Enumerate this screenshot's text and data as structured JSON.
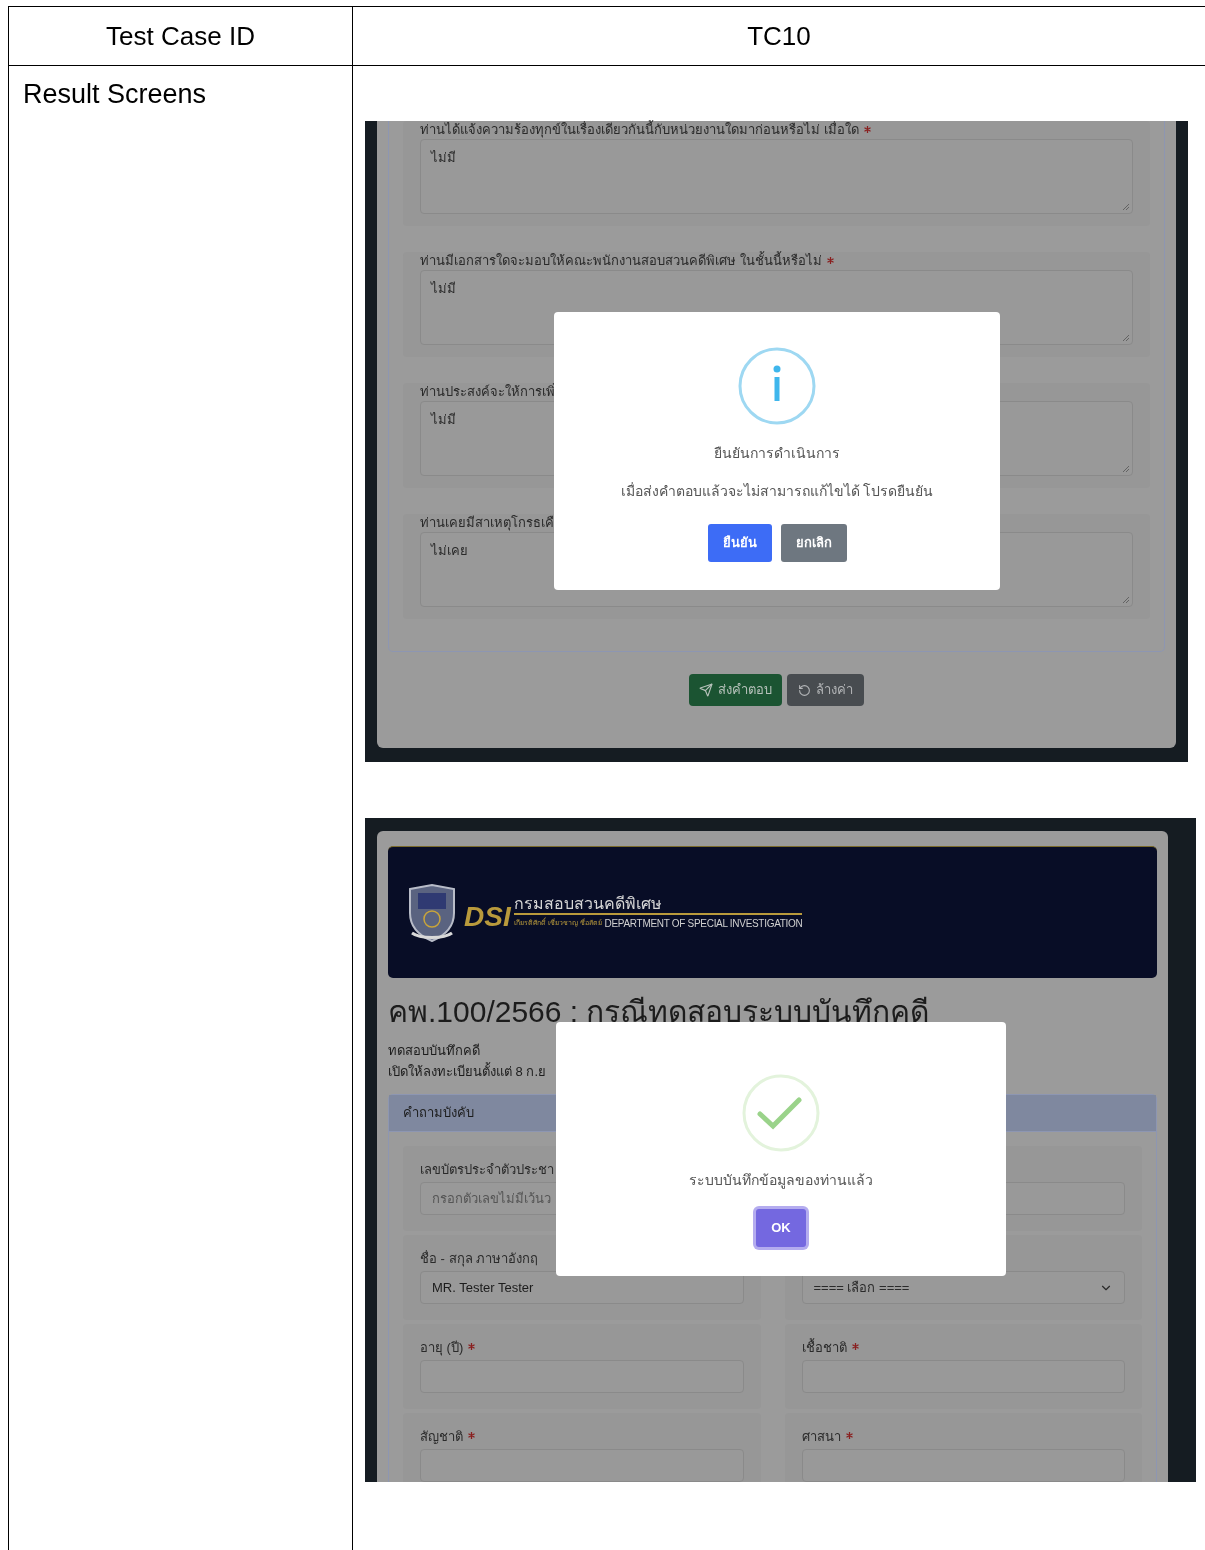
{
  "header": {
    "label": "Test Case ID",
    "value": "TC10"
  },
  "section_label": "Result Screens",
  "confirm_screen": {
    "questions": [
      {
        "label": "ท่านได้แจ้งความร้องทุกข์ในเรื่องเดียวกันนี้กับหน่วยงานใดมาก่อนหรือไม่ เมื่อใด",
        "required": true,
        "answer": "ไม่มี"
      },
      {
        "label": "ท่านมีเอกสารใดจะมอบให้คณะพนักงานสอบสวนคดีพิเศษ ในชั้นนี้หรือไม่",
        "required": true,
        "answer": "ไม่มี"
      },
      {
        "label": "ท่านประสงค์จะให้การเพิ่",
        "answer": "ไม่มี"
      },
      {
        "label": "ท่านเคยมีสาเหตุโกรธเคื",
        "answer": "ไม่เคย"
      }
    ],
    "actions": [
      {
        "kind": "submit",
        "label": "ส่งคำตอบ"
      },
      {
        "kind": "reset",
        "label": "ล้างค่า"
      }
    ],
    "dialog": {
      "title": "ยืนยันการดำเนินการ",
      "message": "เมื่อส่งคำตอบแล้วจะไม่สามารถแก้ไขได้ โปรดยืนยัน",
      "buttons": [
        {
          "kind": "confirm",
          "label": "ยืนยัน"
        },
        {
          "kind": "cancel",
          "label": "ยกเลิก"
        }
      ]
    }
  },
  "success_screen": {
    "banner": {
      "abbr": "DSI",
      "thai_name": "กรมสอบสวนคดีพิเศษ",
      "motto": "เกียรติศักดิ์ เชี่ยวชาญ ซื่อสัตย์",
      "english_name": "DEPARTMENT OF SPECIAL INVESTIGATION"
    },
    "title": "คพ.100/2566 : กรณีทดสอบระบบบันทึกคดี",
    "subtitle_lines": [
      "ทดสอบบันทึกคดี",
      "เปิดให้ลงทะเบียนตั้งแต่ 8 ก.ย"
    ],
    "panel_title": "คำถามบังคับ",
    "fields": [
      {
        "kind": "text",
        "label": "เลขบัตรประจำตัวประชา",
        "placeholder": "กรอกตัวเลขไม่มีเว้นว"
      },
      {
        "kind": "text"
      },
      {
        "kind": "text",
        "label": "ชื่อ - สกุล ภาษาอังกฤ",
        "value": "MR. Tester Tester"
      },
      {
        "kind": "select",
        "value": "==== เลือก ===="
      },
      {
        "kind": "text",
        "label": "อายุ (ปี)",
        "required": true
      },
      {
        "kind": "text",
        "label": "เชื้อชาติ",
        "required": true
      },
      {
        "kind": "text",
        "label": "สัญชาติ",
        "required": true
      },
      {
        "kind": "text",
        "label": "ศาสนา",
        "required": true
      }
    ],
    "dialog": {
      "message": "ระบบบันทึกข้อมูลของท่านแล้ว",
      "buttons": [
        {
          "kind": "ok",
          "label": "OK",
          "focused": true
        }
      ]
    }
  }
}
